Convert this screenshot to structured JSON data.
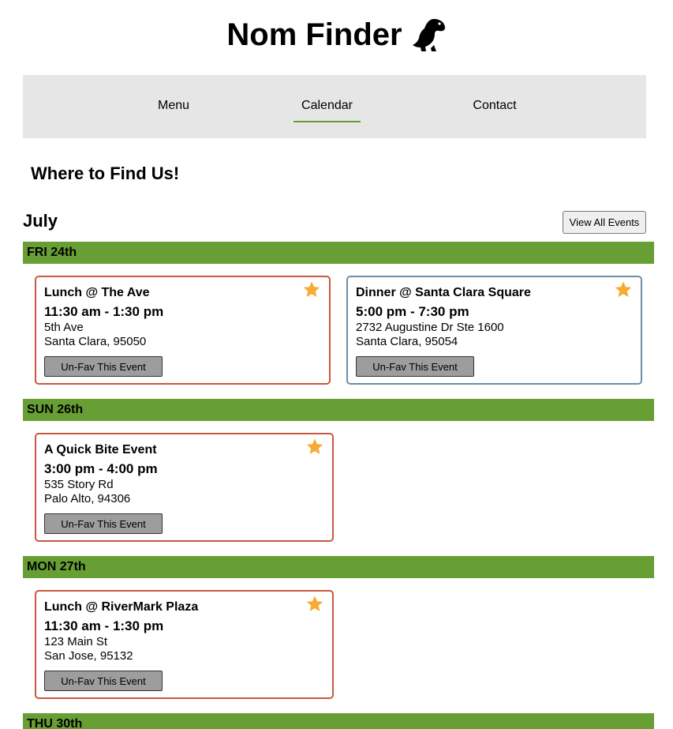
{
  "header": {
    "title": "Nom Finder"
  },
  "nav": {
    "items": [
      "Menu",
      "Calendar",
      "Contact"
    ]
  },
  "page": {
    "section_title": "Where to Find Us!",
    "month": "July",
    "view_all_label": "View All Events"
  },
  "colors": {
    "accent_green": "#679f34",
    "card_border_red": "#c8583e",
    "card_border_blue": "#6a8fa8",
    "star": "#f7ab35"
  },
  "days": [
    {
      "label": "FRI 24th",
      "events": [
        {
          "title": "Lunch @ The Ave",
          "time": "11:30 am - 1:30 pm",
          "addr1": "5th Ave",
          "addr2": "Santa Clara, 95050",
          "button": "Un-Fav This Event",
          "favorited": true
        },
        {
          "title": "Dinner @ Santa Clara Square",
          "time": "5:00 pm - 7:30 pm",
          "addr1": "2732 Augustine Dr Ste 1600",
          "addr2": "Santa Clara, 95054",
          "button": "Un-Fav This Event",
          "favorited": true
        }
      ]
    },
    {
      "label": "SUN 26th",
      "events": [
        {
          "title": "A Quick Bite Event",
          "time": "3:00 pm - 4:00 pm",
          "addr1": "535 Story Rd",
          "addr2": "Palo Alto, 94306",
          "button": "Un-Fav This Event",
          "favorited": true
        }
      ]
    },
    {
      "label": "MON 27th",
      "events": [
        {
          "title": "Lunch @ RiverMark Plaza",
          "time": "11:30 am - 1:30 pm",
          "addr1": "123 Main St",
          "addr2": "San Jose, 95132",
          "button": "Un-Fav This Event",
          "favorited": true
        }
      ]
    },
    {
      "label": "THU 30th",
      "events": []
    }
  ]
}
